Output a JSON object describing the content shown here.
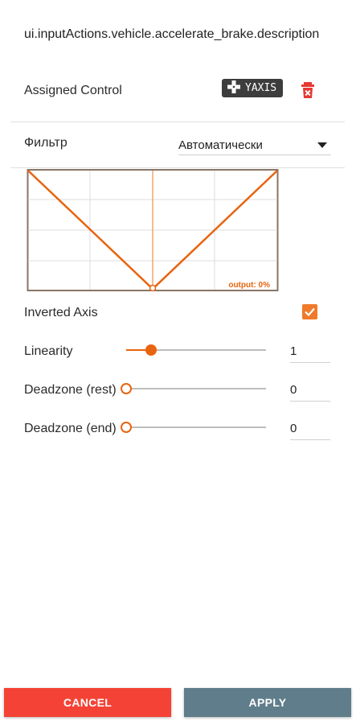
{
  "title": "ui.inputActions.vehicle.accelerate_brake.description",
  "assigned_control": {
    "label": "Assigned Control",
    "control_name": "YAXIS",
    "icon": "gamepad-dpad-icon",
    "remove_icon": "trash-delete-icon"
  },
  "filter": {
    "label": "Фильтр",
    "value": "Автоматически"
  },
  "graph": {
    "output_label": "output: 0%",
    "accent": "#e8640f"
  },
  "inverted_axis": {
    "label": "Inverted Axis",
    "checked": true
  },
  "linearity": {
    "label": "Linearity",
    "value": "1",
    "slider_fraction": 0.18
  },
  "deadzone_rest": {
    "label": "Deadzone (rest)",
    "value": "0",
    "slider_fraction": 0
  },
  "deadzone_end": {
    "label": "Deadzone (end)",
    "value": "0",
    "slider_fraction": 0
  },
  "buttons": {
    "cancel": "CANCEL",
    "apply": "APPLY"
  },
  "colors": {
    "cancel": "#f44336",
    "apply": "#607d8b",
    "accent": "#e8640f"
  }
}
